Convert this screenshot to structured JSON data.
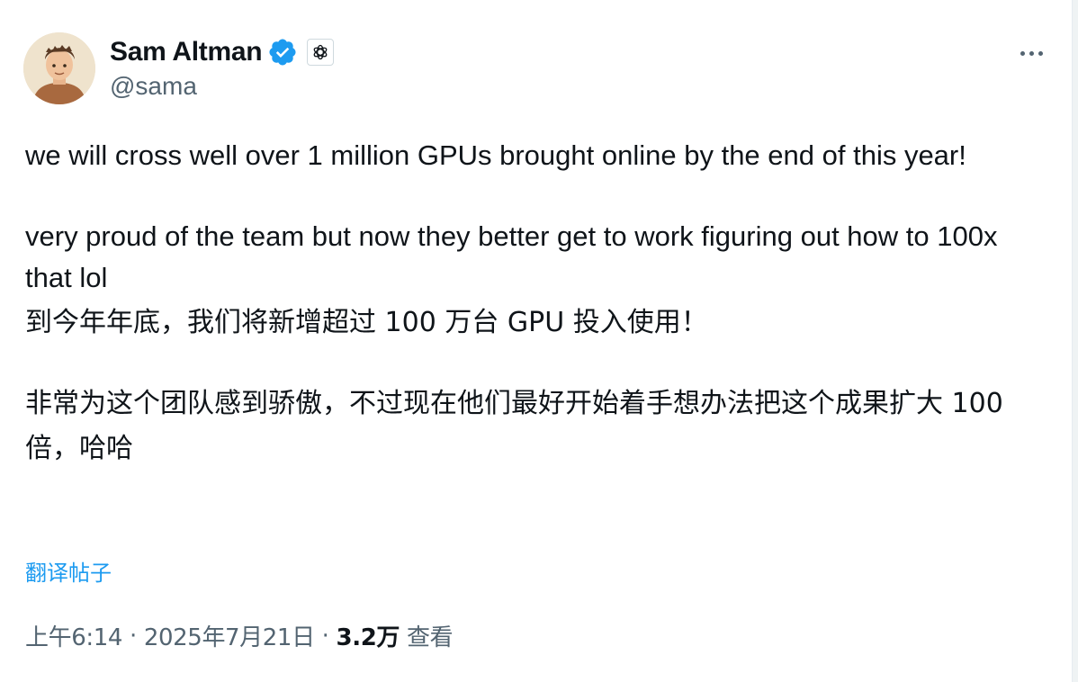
{
  "author": {
    "display_name": "Sam Altman",
    "handle": "@sama",
    "verified": true,
    "affiliation_icon": "openai-logo-icon"
  },
  "more_icon": "more-horizontal-icon",
  "post": {
    "paragraphs_en": [
      "we will cross well over 1 million GPUs brought online by the end of this year!",
      "very proud of the team but now they better get to work figuring out how to 100x that lol"
    ],
    "paragraphs_zh": [
      "到今年年底，我们将新增超过 100 万台 GPU 投入使用！",
      "非常为这个团队感到骄傲，不过现在他们最好开始着手想办法把这个成果扩大 100 倍，哈哈"
    ]
  },
  "translate_link": "翻译帖子",
  "meta": {
    "time": "上午6:14",
    "date": "2025年7月21日",
    "views_count": "3.2万",
    "views_label": "查看",
    "separator": "·"
  },
  "colors": {
    "text_primary": "#0f1419",
    "text_secondary": "#536471",
    "link": "#1d9bf0",
    "verified_badge": "#1d9bf0"
  }
}
